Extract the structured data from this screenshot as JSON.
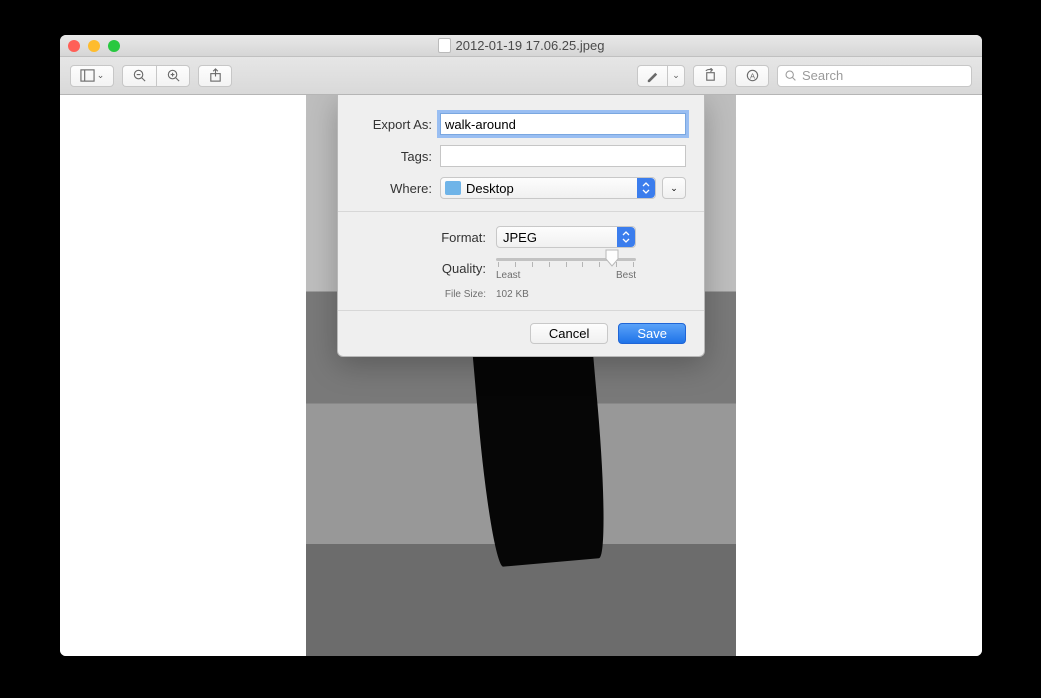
{
  "window": {
    "title": "2012-01-19 17.06.25.jpeg"
  },
  "toolbar": {
    "search_placeholder": "Search"
  },
  "export": {
    "export_as_label": "Export As:",
    "export_as_value": "walk-around",
    "tags_label": "Tags:",
    "tags_value": "",
    "where_label": "Where:",
    "where_value": "Desktop",
    "format_label": "Format:",
    "format_value": "JPEG",
    "quality_label": "Quality:",
    "quality_least": "Least",
    "quality_best": "Best",
    "quality_position": 0.8,
    "filesize_label": "File Size:",
    "filesize_value": "102 KB",
    "cancel": "Cancel",
    "save": "Save"
  }
}
